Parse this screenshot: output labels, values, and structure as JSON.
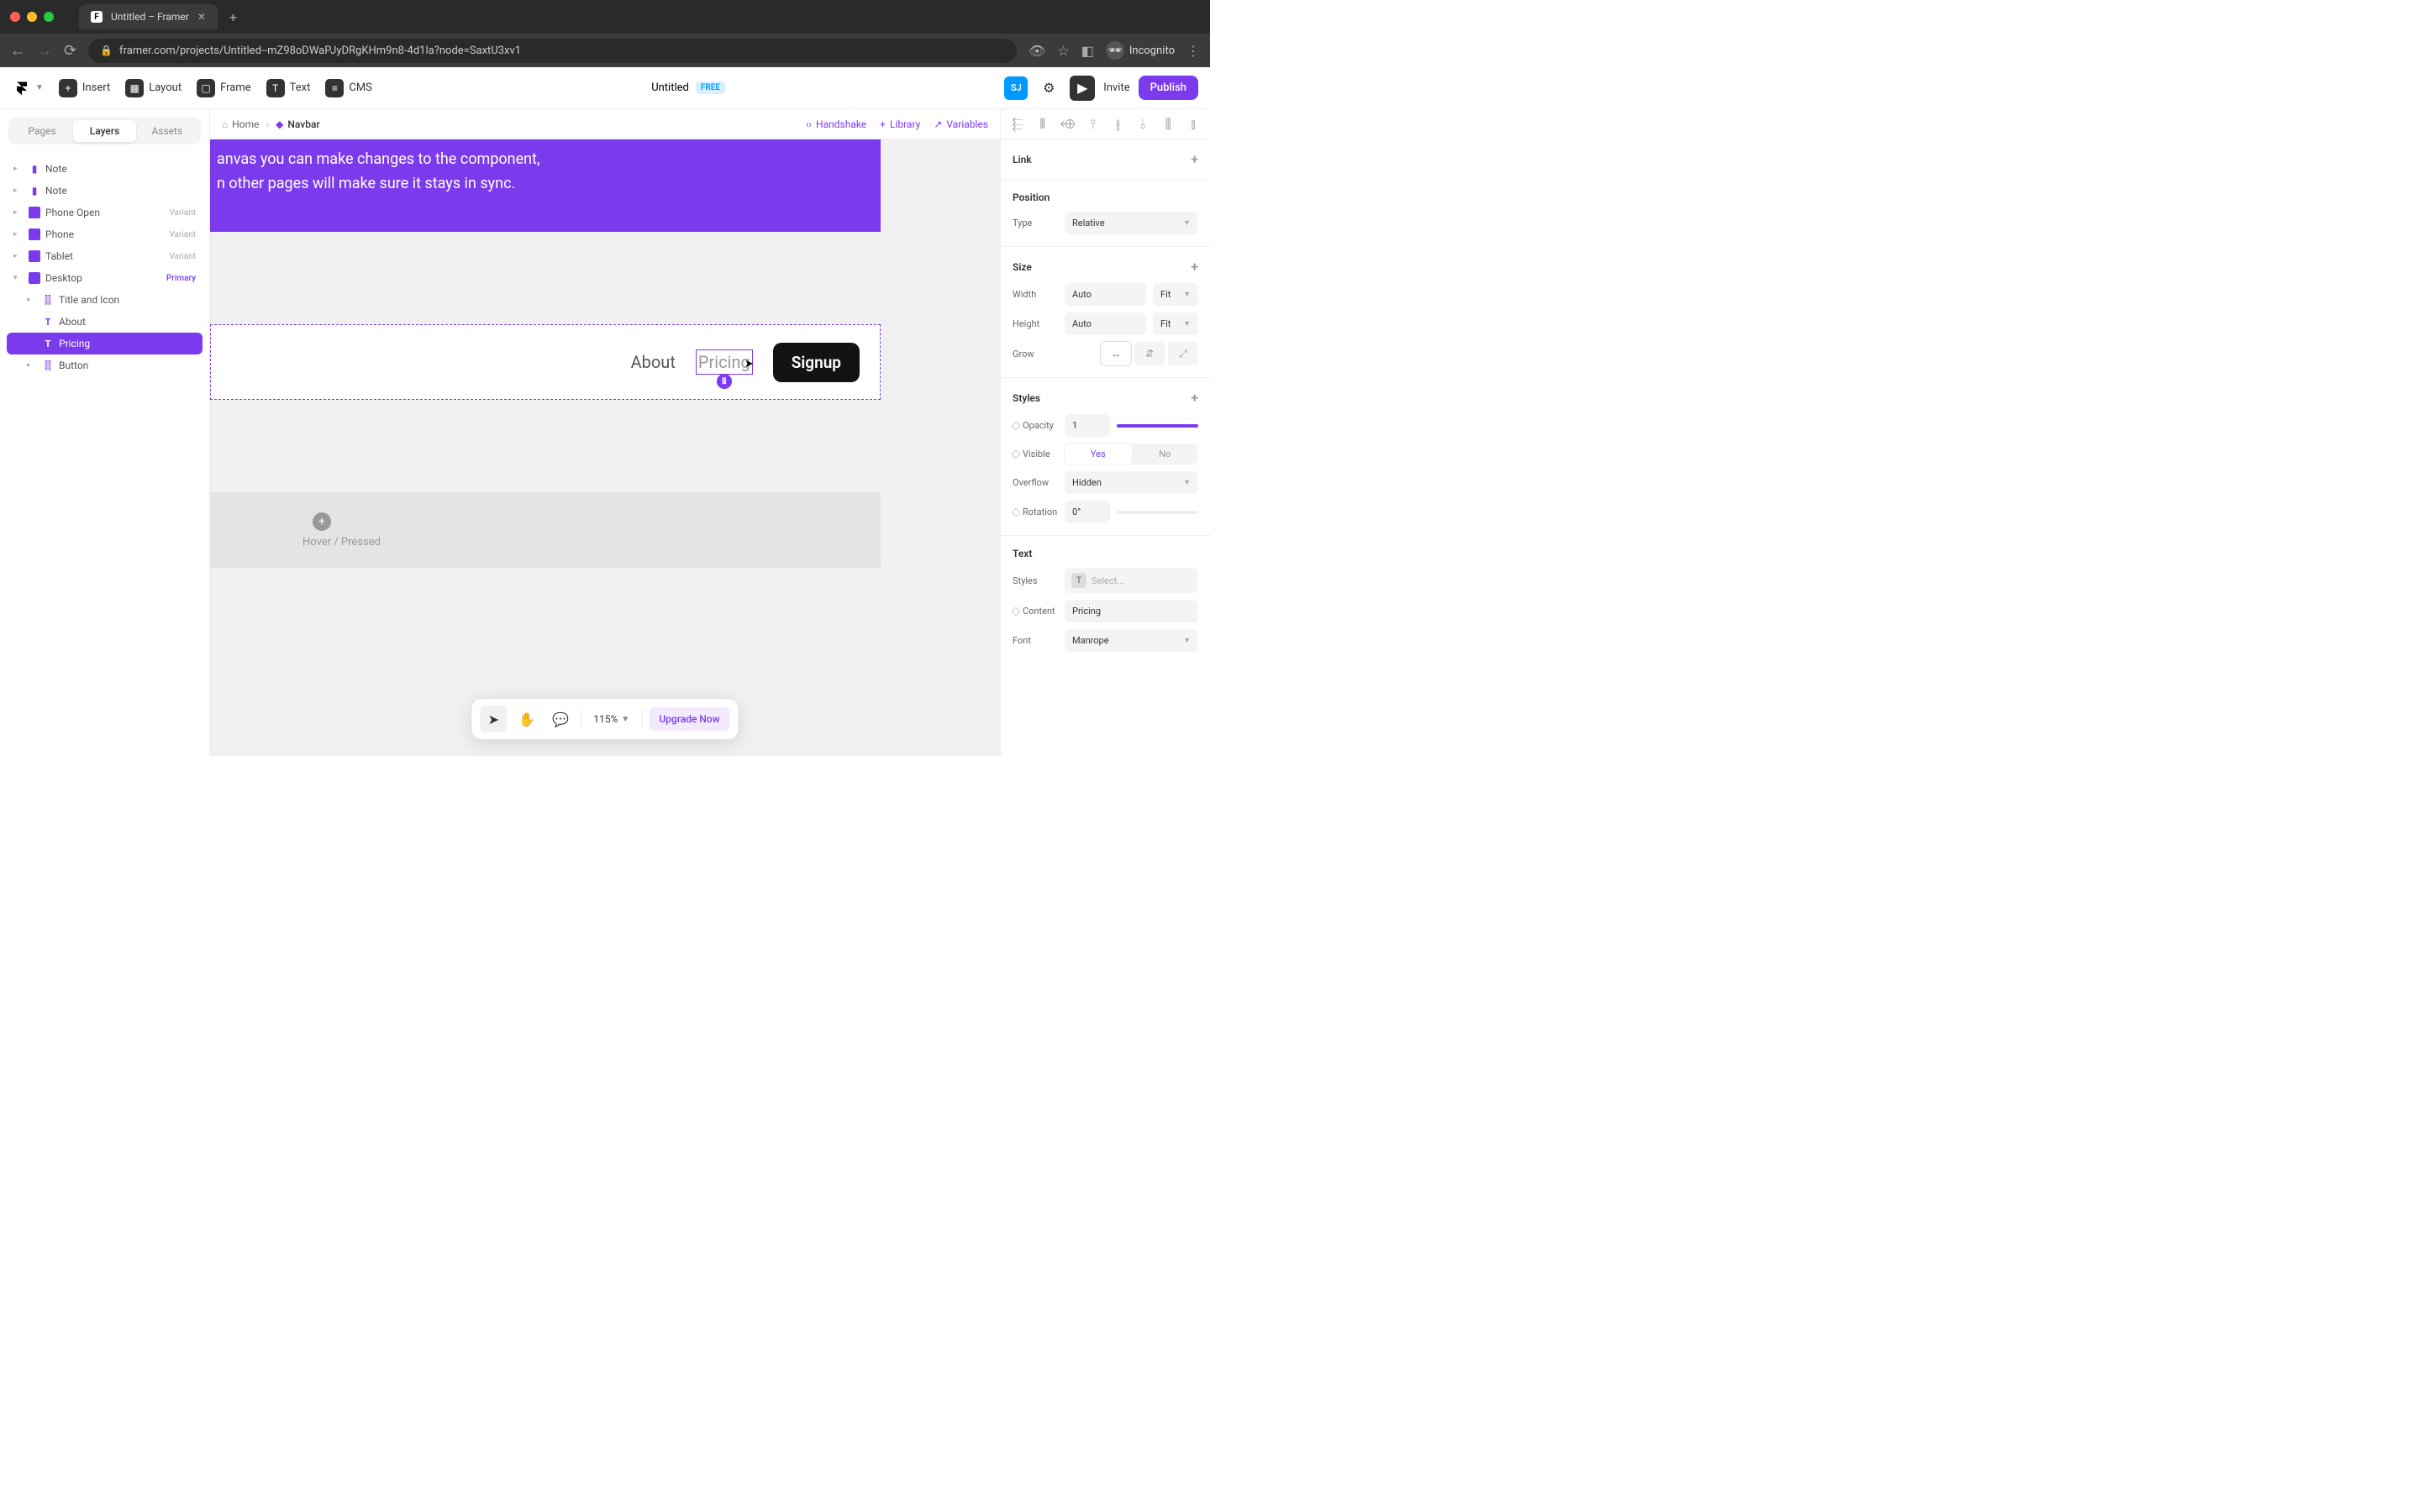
{
  "browser": {
    "tab_title": "Untitled – Framer",
    "url": "framer.com/projects/Untitled--mZ98oDWaPJyDRgKHm9n8-4d1la?node=SaxtU3xv1",
    "incognito_label": "Incognito"
  },
  "toolbar": {
    "insert": "Insert",
    "layout": "Layout",
    "frame": "Frame",
    "text": "Text",
    "cms": "CMS",
    "doc_title": "Untitled",
    "free_badge": "FREE",
    "avatar_initials": "SJ",
    "invite": "Invite",
    "publish": "Publish"
  },
  "sidebar": {
    "tabs": {
      "pages": "Pages",
      "layers": "Layers",
      "assets": "Assets"
    },
    "layers": [
      {
        "label": "Note",
        "type": "note"
      },
      {
        "label": "Note",
        "type": "note"
      },
      {
        "label": "Phone Open",
        "type": "variant",
        "tag": "Variant"
      },
      {
        "label": "Phone",
        "type": "variant",
        "tag": "Variant"
      },
      {
        "label": "Tablet",
        "type": "variant",
        "tag": "Variant"
      },
      {
        "label": "Desktop",
        "type": "variant",
        "tag": "Primary"
      },
      {
        "label": "Title and Icon",
        "type": "stack",
        "indent": 1
      },
      {
        "label": "About",
        "type": "text",
        "indent": 1
      },
      {
        "label": "Pricing",
        "type": "text",
        "indent": 1,
        "selected": true
      },
      {
        "label": "Button",
        "type": "stack",
        "indent": 1
      }
    ]
  },
  "canvas": {
    "breadcrumb": {
      "home": "Home",
      "current": "Navbar"
    },
    "actions": {
      "handshake": "Handshake",
      "library": "Library",
      "variables": "Variables"
    },
    "purple_text_line1": "anvas you can make changes to the component,",
    "purple_text_line2": "n other pages will make sure it stays in sync.",
    "nav_about": "About",
    "nav_pricing": "Pricing",
    "nav_signup": "Signup",
    "hover_label": "Hover / Pressed"
  },
  "inspector": {
    "link": {
      "title": "Link"
    },
    "position": {
      "title": "Position",
      "type_label": "Type",
      "type_value": "Relative"
    },
    "size": {
      "title": "Size",
      "width_label": "Width",
      "width_value": "Auto",
      "width_mode": "Fit",
      "height_label": "Height",
      "height_value": "Auto",
      "height_mode": "Fit",
      "grow_label": "Grow"
    },
    "styles": {
      "title": "Styles",
      "opacity_label": "Opacity",
      "opacity_value": "1",
      "visible_label": "Visible",
      "visible_yes": "Yes",
      "visible_no": "No",
      "overflow_label": "Overflow",
      "overflow_value": "Hidden",
      "rotation_label": "Rotation",
      "rotation_value": "0°"
    },
    "text": {
      "title": "Text",
      "styles_label": "Styles",
      "styles_placeholder": "Select...",
      "content_label": "Content",
      "content_value": "Pricing",
      "font_label": "Font",
      "font_value": "Manrope"
    }
  },
  "float": {
    "zoom": "115%",
    "upgrade": "Upgrade Now"
  }
}
